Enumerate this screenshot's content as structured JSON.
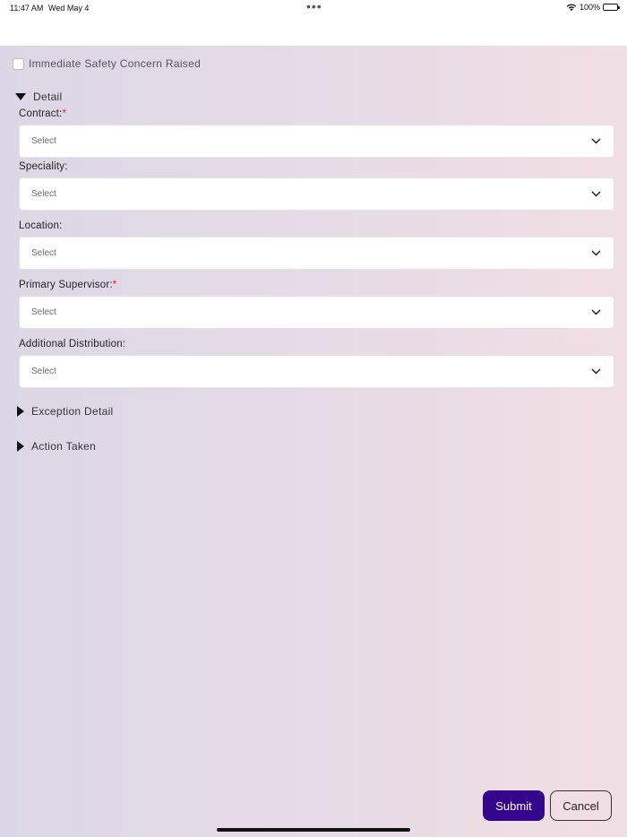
{
  "status_bar": {
    "time": "11:47 AM",
    "date": "Wed May 4",
    "dots": "•••",
    "battery": "100%"
  },
  "form": {
    "safety_concern_label": "Immediate Safety Concern Raised",
    "sections": {
      "detail": "Detail",
      "exception_detail": "Exception Detail",
      "action_taken": "Action Taken"
    },
    "fields": [
      {
        "label": "Contract:",
        "required": true,
        "value": "Select"
      },
      {
        "label": "Speciality:",
        "required": false,
        "value": "Select"
      },
      {
        "label": "Location:",
        "required": false,
        "value": "Select"
      },
      {
        "label": "Primary Supervisor:",
        "required": true,
        "value": "Select"
      },
      {
        "label": "Additional Distribution:",
        "required": false,
        "value": "Select"
      }
    ],
    "required_marker": "*"
  },
  "actions": {
    "submit": "Submit",
    "cancel": "Cancel"
  },
  "colors": {
    "submit_bg": "#35058c",
    "required": "#e0201b"
  },
  "icons": {
    "wifi": "wifi-icon",
    "battery": "battery-icon",
    "chevron": "chevron-down-icon",
    "expanded": "triangle-down-icon",
    "collapsed": "triangle-right-icon"
  }
}
